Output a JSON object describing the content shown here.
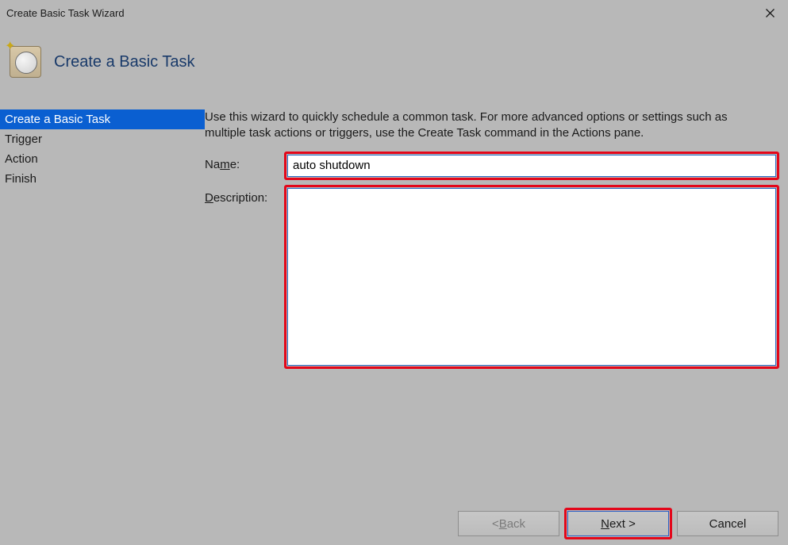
{
  "window": {
    "title": "Create Basic Task Wizard"
  },
  "header": {
    "title": "Create a Basic Task"
  },
  "sidebar": {
    "items": [
      {
        "label": "Create a Basic Task",
        "active": true
      },
      {
        "label": "Trigger",
        "active": false
      },
      {
        "label": "Action",
        "active": false
      },
      {
        "label": "Finish",
        "active": false
      }
    ]
  },
  "main": {
    "instruction": "Use this wizard to quickly schedule a common task.  For more advanced options or settings such as multiple task actions or triggers, use the Create Task command in the Actions pane.",
    "name_label_prefix": "Na",
    "name_label_hotkey": "m",
    "name_label_suffix": "e:",
    "name_value": "auto shutdown",
    "desc_label_hotkey": "D",
    "desc_label_suffix": "escription:",
    "desc_value": ""
  },
  "buttons": {
    "back_prefix": "< ",
    "back_hotkey": "B",
    "back_suffix": "ack",
    "next_hotkey": "N",
    "next_suffix": "ext >",
    "cancel": "Cancel"
  },
  "highlight_color": "#e3071a"
}
